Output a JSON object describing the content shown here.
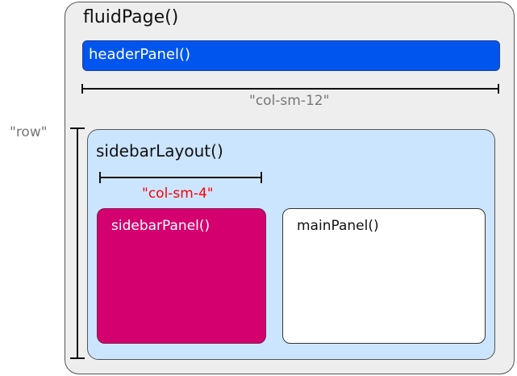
{
  "fluid_page": {
    "label": "fluidPage()"
  },
  "header_panel": {
    "label": "headerPanel()"
  },
  "col_sm_12": {
    "label": "\"col-sm-12\""
  },
  "row": {
    "label": "\"row\""
  },
  "sidebar_layout": {
    "label": "sidebarLayout()"
  },
  "col_sm_4": {
    "label": "\"col-sm-4\""
  },
  "sidebar_panel": {
    "label": "sidebarPanel()"
  },
  "main_panel": {
    "label": "mainPanel()"
  },
  "colors": {
    "header": "#0055ee",
    "layout": "#cce5ff",
    "sidebar": "#d4006f",
    "red_label": "#ff0000"
  }
}
